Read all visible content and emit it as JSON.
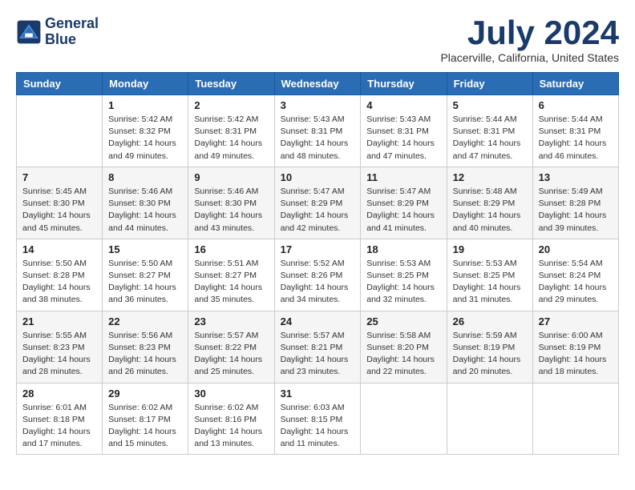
{
  "header": {
    "logo_line1": "General",
    "logo_line2": "Blue",
    "month_title": "July 2024",
    "location": "Placerville, California, United States"
  },
  "days_of_week": [
    "Sunday",
    "Monday",
    "Tuesday",
    "Wednesday",
    "Thursday",
    "Friday",
    "Saturday"
  ],
  "weeks": [
    [
      {
        "day": "",
        "info": ""
      },
      {
        "day": "1",
        "info": "Sunrise: 5:42 AM\nSunset: 8:32 PM\nDaylight: 14 hours\nand 49 minutes."
      },
      {
        "day": "2",
        "info": "Sunrise: 5:42 AM\nSunset: 8:31 PM\nDaylight: 14 hours\nand 49 minutes."
      },
      {
        "day": "3",
        "info": "Sunrise: 5:43 AM\nSunset: 8:31 PM\nDaylight: 14 hours\nand 48 minutes."
      },
      {
        "day": "4",
        "info": "Sunrise: 5:43 AM\nSunset: 8:31 PM\nDaylight: 14 hours\nand 47 minutes."
      },
      {
        "day": "5",
        "info": "Sunrise: 5:44 AM\nSunset: 8:31 PM\nDaylight: 14 hours\nand 47 minutes."
      },
      {
        "day": "6",
        "info": "Sunrise: 5:44 AM\nSunset: 8:31 PM\nDaylight: 14 hours\nand 46 minutes."
      }
    ],
    [
      {
        "day": "7",
        "info": "Sunrise: 5:45 AM\nSunset: 8:30 PM\nDaylight: 14 hours\nand 45 minutes."
      },
      {
        "day": "8",
        "info": "Sunrise: 5:46 AM\nSunset: 8:30 PM\nDaylight: 14 hours\nand 44 minutes."
      },
      {
        "day": "9",
        "info": "Sunrise: 5:46 AM\nSunset: 8:30 PM\nDaylight: 14 hours\nand 43 minutes."
      },
      {
        "day": "10",
        "info": "Sunrise: 5:47 AM\nSunset: 8:29 PM\nDaylight: 14 hours\nand 42 minutes."
      },
      {
        "day": "11",
        "info": "Sunrise: 5:47 AM\nSunset: 8:29 PM\nDaylight: 14 hours\nand 41 minutes."
      },
      {
        "day": "12",
        "info": "Sunrise: 5:48 AM\nSunset: 8:29 PM\nDaylight: 14 hours\nand 40 minutes."
      },
      {
        "day": "13",
        "info": "Sunrise: 5:49 AM\nSunset: 8:28 PM\nDaylight: 14 hours\nand 39 minutes."
      }
    ],
    [
      {
        "day": "14",
        "info": "Sunrise: 5:50 AM\nSunset: 8:28 PM\nDaylight: 14 hours\nand 38 minutes."
      },
      {
        "day": "15",
        "info": "Sunrise: 5:50 AM\nSunset: 8:27 PM\nDaylight: 14 hours\nand 36 minutes."
      },
      {
        "day": "16",
        "info": "Sunrise: 5:51 AM\nSunset: 8:27 PM\nDaylight: 14 hours\nand 35 minutes."
      },
      {
        "day": "17",
        "info": "Sunrise: 5:52 AM\nSunset: 8:26 PM\nDaylight: 14 hours\nand 34 minutes."
      },
      {
        "day": "18",
        "info": "Sunrise: 5:53 AM\nSunset: 8:25 PM\nDaylight: 14 hours\nand 32 minutes."
      },
      {
        "day": "19",
        "info": "Sunrise: 5:53 AM\nSunset: 8:25 PM\nDaylight: 14 hours\nand 31 minutes."
      },
      {
        "day": "20",
        "info": "Sunrise: 5:54 AM\nSunset: 8:24 PM\nDaylight: 14 hours\nand 29 minutes."
      }
    ],
    [
      {
        "day": "21",
        "info": "Sunrise: 5:55 AM\nSunset: 8:23 PM\nDaylight: 14 hours\nand 28 minutes."
      },
      {
        "day": "22",
        "info": "Sunrise: 5:56 AM\nSunset: 8:23 PM\nDaylight: 14 hours\nand 26 minutes."
      },
      {
        "day": "23",
        "info": "Sunrise: 5:57 AM\nSunset: 8:22 PM\nDaylight: 14 hours\nand 25 minutes."
      },
      {
        "day": "24",
        "info": "Sunrise: 5:57 AM\nSunset: 8:21 PM\nDaylight: 14 hours\nand 23 minutes."
      },
      {
        "day": "25",
        "info": "Sunrise: 5:58 AM\nSunset: 8:20 PM\nDaylight: 14 hours\nand 22 minutes."
      },
      {
        "day": "26",
        "info": "Sunrise: 5:59 AM\nSunset: 8:19 PM\nDaylight: 14 hours\nand 20 minutes."
      },
      {
        "day": "27",
        "info": "Sunrise: 6:00 AM\nSunset: 8:19 PM\nDaylight: 14 hours\nand 18 minutes."
      }
    ],
    [
      {
        "day": "28",
        "info": "Sunrise: 6:01 AM\nSunset: 8:18 PM\nDaylight: 14 hours\nand 17 minutes."
      },
      {
        "day": "29",
        "info": "Sunrise: 6:02 AM\nSunset: 8:17 PM\nDaylight: 14 hours\nand 15 minutes."
      },
      {
        "day": "30",
        "info": "Sunrise: 6:02 AM\nSunset: 8:16 PM\nDaylight: 14 hours\nand 13 minutes."
      },
      {
        "day": "31",
        "info": "Sunrise: 6:03 AM\nSunset: 8:15 PM\nDaylight: 14 hours\nand 11 minutes."
      },
      {
        "day": "",
        "info": ""
      },
      {
        "day": "",
        "info": ""
      },
      {
        "day": "",
        "info": ""
      }
    ]
  ]
}
